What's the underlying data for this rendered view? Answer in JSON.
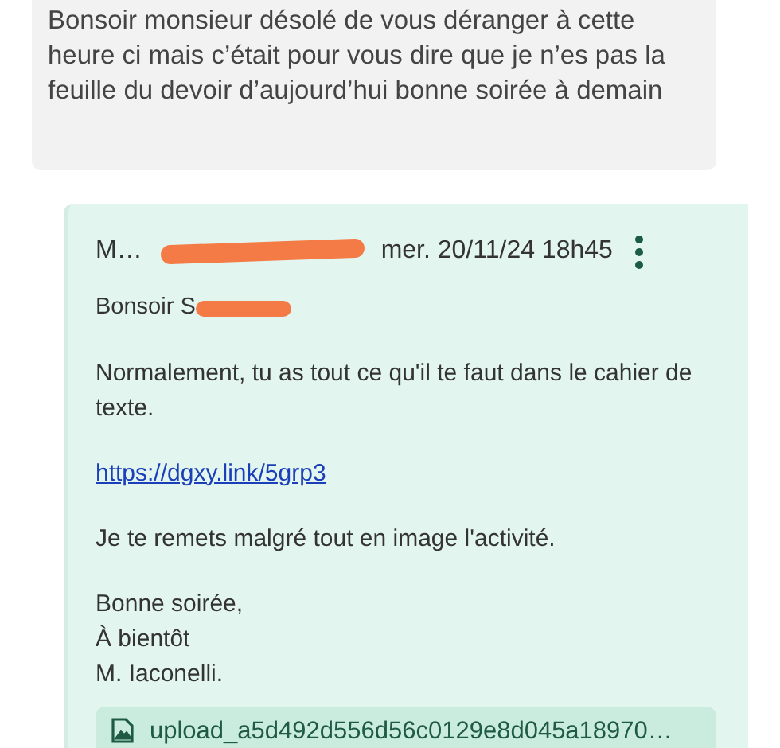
{
  "previous_message": {
    "text": "Bonsoir monsieur désolé de vous déranger à cette heure ci mais c’était pour vous dire que je n’es pas la feuille du devoir d’aujourd’hui bonne soirée à demain"
  },
  "reply": {
    "sender": "M…",
    "date": "mer. 20/11/24 18h45",
    "greeting": "Bonsoir S",
    "paragraphs": [
      {
        "kind": "text",
        "text": "Normalement, tu as tout ce qu'il te faut dans le cahier de texte."
      },
      {
        "kind": "link",
        "text": "https://dgxy.link/5grp3"
      },
      {
        "kind": "text",
        "text": "Je te remets malgré tout en image l'activité."
      }
    ],
    "signature": [
      "Bonne soirée,",
      "À bientôt",
      "M. Iaconelli."
    ],
    "attachment": {
      "name": "upload_a5d492d556d56c0129e8d045a18970…"
    }
  }
}
